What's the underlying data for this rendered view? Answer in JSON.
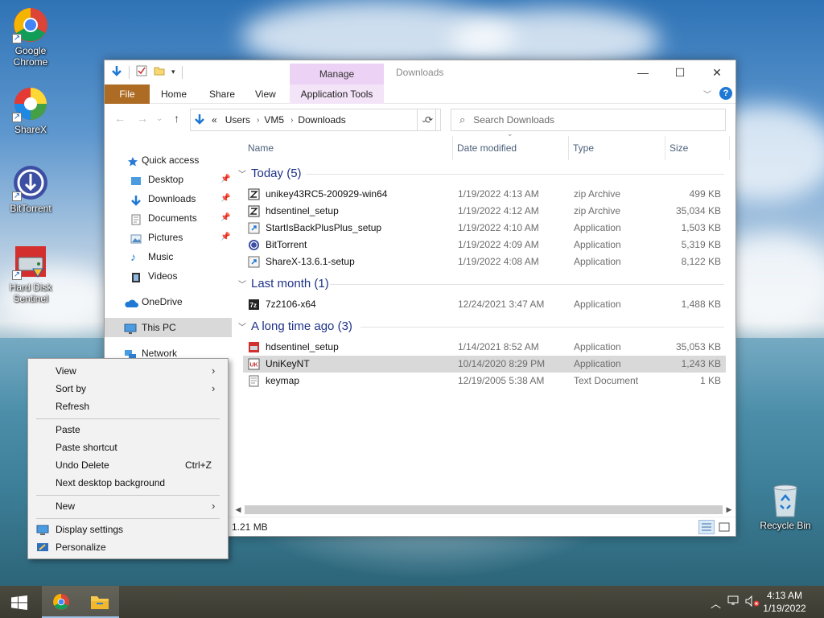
{
  "desktop": {
    "icons": [
      {
        "label": "Google Chrome"
      },
      {
        "label": "ShareX"
      },
      {
        "label": "BitTorrent"
      },
      {
        "label": "Hard Disk Sentinel"
      }
    ],
    "recycle_bin_label": "Recycle Bin"
  },
  "explorer": {
    "title": "Downloads",
    "contextual_tab_group": "Manage",
    "ribbon_tabs": [
      "File",
      "Home",
      "Share",
      "View",
      "Application Tools"
    ],
    "address": {
      "overflow": "«",
      "crumbs": [
        "Users",
        "VM5",
        "Downloads"
      ]
    },
    "search_placeholder": "Search Downloads",
    "nav_pane": [
      {
        "label": "Quick access",
        "icon": "star-icon",
        "pinned": false
      },
      {
        "label": "Desktop",
        "icon": "desktop-folder-icon",
        "pinned": true
      },
      {
        "label": "Downloads",
        "icon": "download-arrow-icon",
        "pinned": true
      },
      {
        "label": "Documents",
        "icon": "documents-icon",
        "pinned": true
      },
      {
        "label": "Pictures",
        "icon": "pictures-icon",
        "pinned": true
      },
      {
        "label": "Music",
        "icon": "music-note-icon",
        "pinned": false
      },
      {
        "label": "Videos",
        "icon": "film-icon",
        "pinned": false
      },
      {
        "label": "OneDrive",
        "icon": "cloud-icon",
        "pinned": false
      },
      {
        "label": "This PC",
        "icon": "monitor-icon",
        "pinned": false,
        "selected": true
      },
      {
        "label": "Network",
        "icon": "network-icon",
        "pinned": false
      }
    ],
    "columns": [
      "Name",
      "Date modified",
      "Type",
      "Size"
    ],
    "groups": [
      {
        "label": "Today (5)",
        "files": [
          {
            "name": "unikey43RC5-200929-win64",
            "date": "1/19/2022 4:13 AM",
            "type": "zip Archive",
            "size": "499 KB",
            "icon": "zip-icon"
          },
          {
            "name": "hdsentinel_setup",
            "date": "1/19/2022 4:12 AM",
            "type": "zip Archive",
            "size": "35,034 KB",
            "icon": "zip-icon"
          },
          {
            "name": "StartIsBackPlusPlus_setup",
            "date": "1/19/2022 4:10 AM",
            "type": "Application",
            "size": "1,503 KB",
            "icon": "setup-icon"
          },
          {
            "name": "BitTorrent",
            "date": "1/19/2022 4:09 AM",
            "type": "Application",
            "size": "5,319 KB",
            "icon": "bittorrent-icon"
          },
          {
            "name": "ShareX-13.6.1-setup",
            "date": "1/19/2022 4:08 AM",
            "type": "Application",
            "size": "8,122 KB",
            "icon": "setup-icon"
          }
        ]
      },
      {
        "label": "Last month (1)",
        "files": [
          {
            "name": "7z2106-x64",
            "date": "12/24/2021 3:47 AM",
            "type": "Application",
            "size": "1,488 KB",
            "icon": "7zip-icon"
          }
        ]
      },
      {
        "label": "A long time ago (3)",
        "files": [
          {
            "name": "hdsentinel_setup",
            "date": "1/14/2021 8:52 AM",
            "type": "Application",
            "size": "35,053 KB",
            "icon": "hdsentinel-icon"
          },
          {
            "name": "UniKeyNT",
            "date": "10/14/2020 8:29 PM",
            "type": "Application",
            "size": "1,243 KB",
            "icon": "unikey-icon",
            "selected": true
          },
          {
            "name": "keymap",
            "date": "12/19/2005 5:38 AM",
            "type": "Text Document",
            "size": "1 KB",
            "icon": "text-file-icon"
          }
        ]
      }
    ],
    "status_text": "1.21 MB"
  },
  "context_menu": {
    "items": [
      {
        "label": "View",
        "submenu": true
      },
      {
        "label": "Sort by",
        "submenu": true
      },
      {
        "label": "Refresh"
      },
      {
        "label": "Paste"
      },
      {
        "label": "Paste shortcut"
      },
      {
        "label": "Undo Delete",
        "shortcut": "Ctrl+Z"
      },
      {
        "label": "Next desktop background"
      },
      {
        "label": "New",
        "submenu": true
      },
      {
        "label": "Display settings",
        "icon": "display-icon"
      },
      {
        "label": "Personalize",
        "icon": "personalize-icon"
      }
    ]
  },
  "taskbar": {
    "clock_time": "4:13 AM",
    "clock_date": "1/19/2022"
  },
  "colors": {
    "file_tab": "#ad6b24",
    "manage_tab": "#ecd2f4",
    "group_header": "#1e3287",
    "selection": "#d9d9d9"
  }
}
